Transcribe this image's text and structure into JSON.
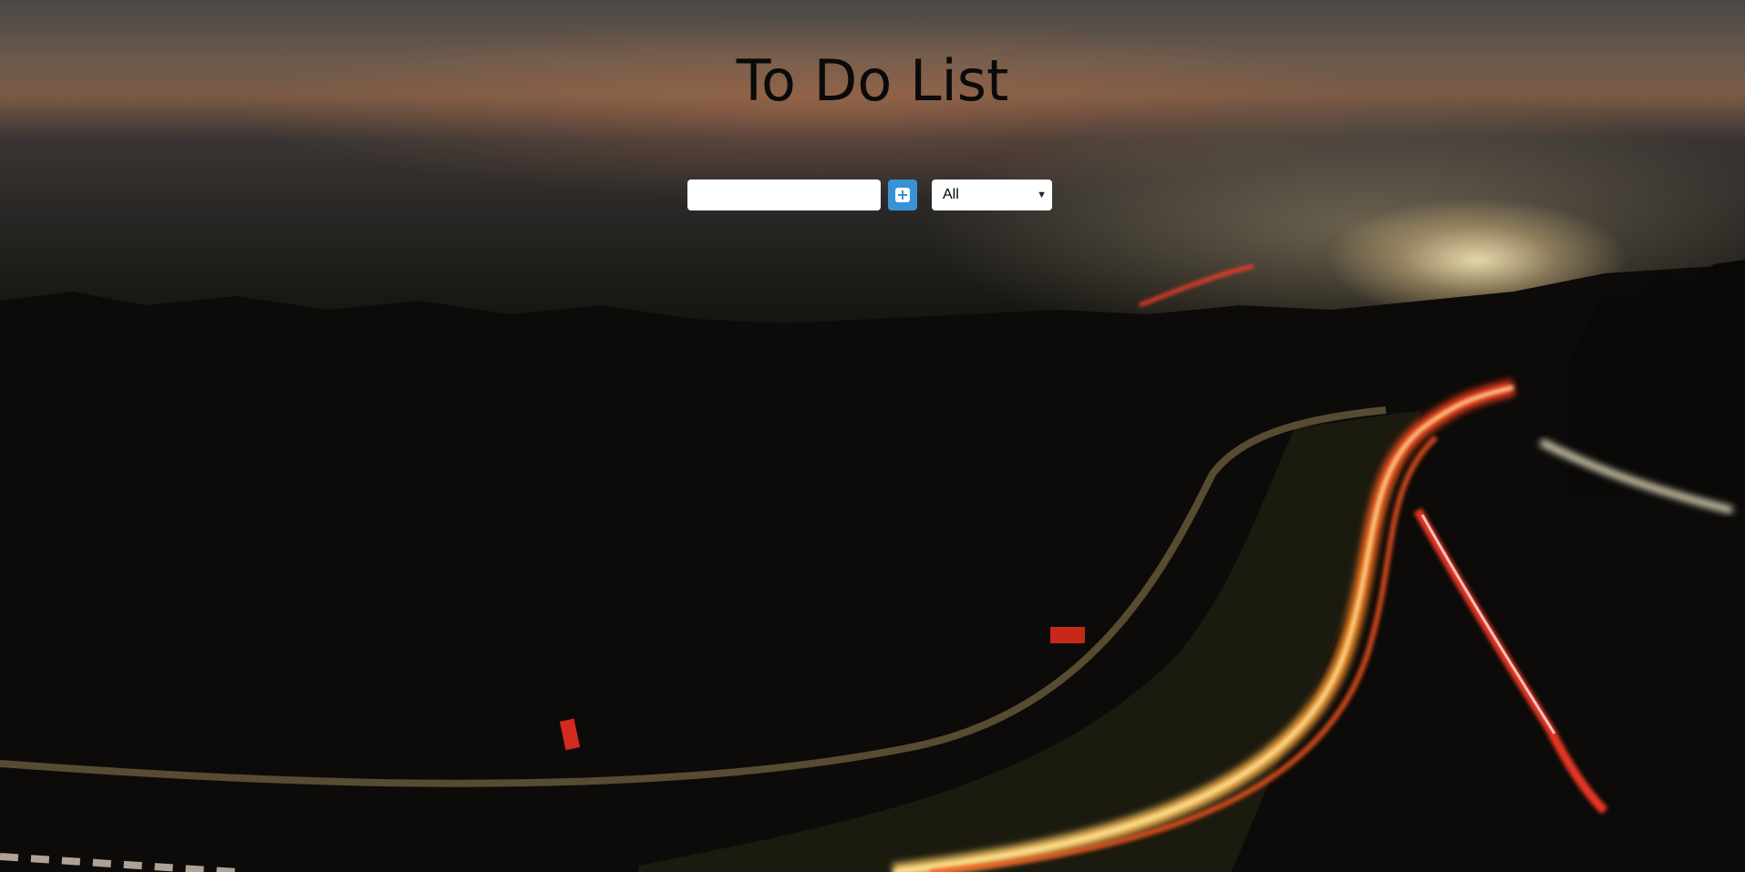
{
  "page": {
    "title": "To Do List"
  },
  "form": {
    "input_value": "",
    "input_placeholder": "",
    "add_button_icon": "plus-square-icon",
    "filter_selected": "All"
  },
  "colors": {
    "add_button": "#3a92d6",
    "title": "#0a0a0a"
  }
}
